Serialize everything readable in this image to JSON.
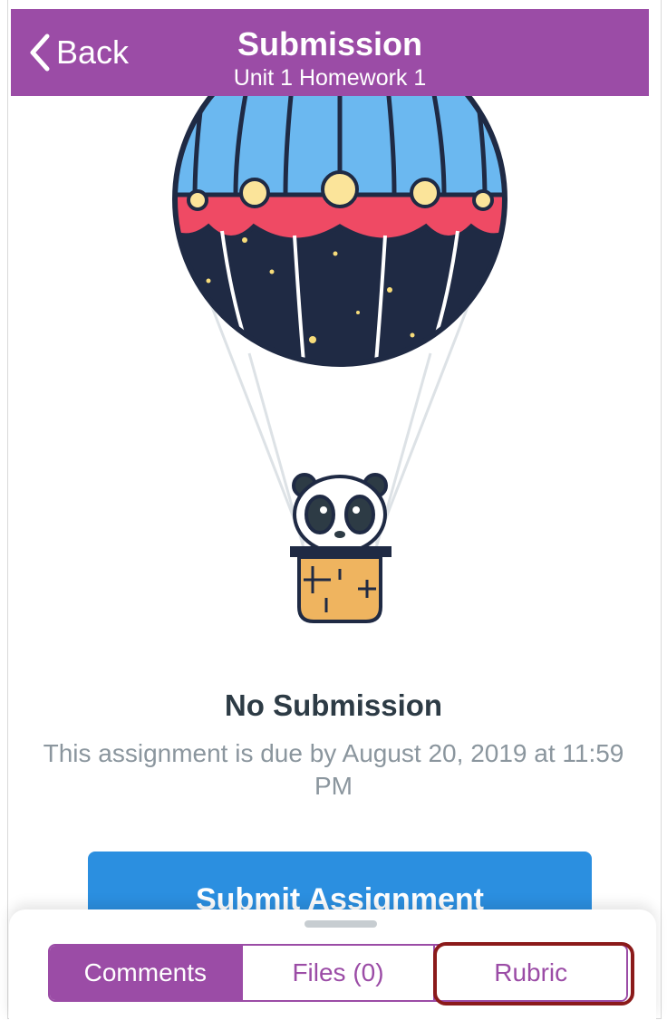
{
  "header": {
    "back_label": "Back",
    "title": "Submission",
    "subtitle": "Unit 1 Homework 1"
  },
  "empty_state": {
    "title": "No Submission",
    "description": "This assignment is due by August 20, 2019 at 11:59 PM",
    "illustration": "panda-hot-air-balloon"
  },
  "submit_button": {
    "label": "Submit Assignment"
  },
  "drawer": {
    "tabs": [
      {
        "label": "Comments",
        "selected": true
      },
      {
        "label": "Files (0)",
        "selected": false
      },
      {
        "label": "Rubric",
        "selected": false
      }
    ]
  },
  "colors": {
    "brand": "#9b4ca6",
    "submit": "#2b8fe0",
    "highlight": "#8b1a1a"
  }
}
